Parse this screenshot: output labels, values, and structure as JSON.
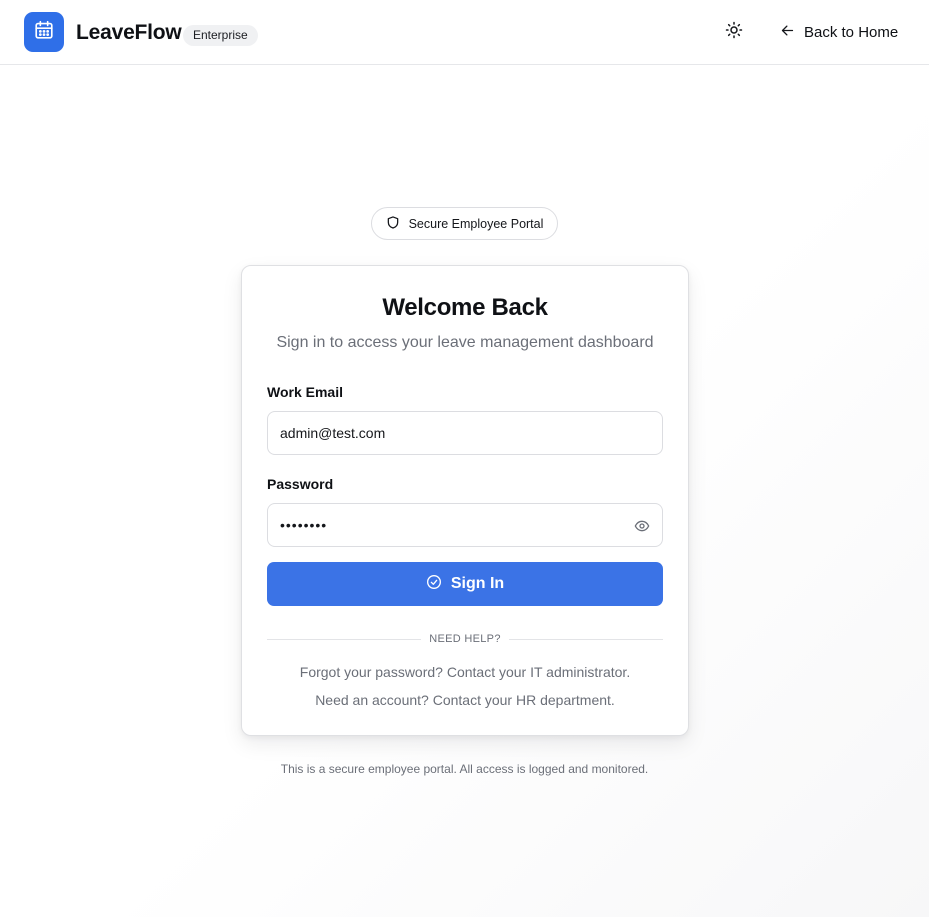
{
  "header": {
    "brand": "LeaveFlow",
    "badge": "Enterprise",
    "logo_icon": "calendar-icon",
    "theme_icon": "sun-icon",
    "back_icon": "arrow-left-icon",
    "back_label": "Back to Home"
  },
  "portal_pill": {
    "icon": "shield-icon",
    "label": "Secure Employee Portal"
  },
  "login_card": {
    "title": "Welcome Back",
    "subtitle": "Sign in to access your leave management dashboard",
    "email": {
      "label": "Work Email",
      "value": "admin@test.com"
    },
    "password": {
      "label": "Password",
      "value": "••••••••",
      "toggle_icon": "eye-icon"
    },
    "submit": {
      "icon": "check-circle-icon",
      "label": "Sign In"
    },
    "divider_text": "NEED HELP?",
    "help_lines": [
      "Forgot your password? Contact your IT administrator.",
      "Need an account? Contact your HR department."
    ]
  },
  "footer_note": "This is a secure employee portal. All access is logged and monitored.",
  "colors": {
    "primary": "#3b73e6",
    "logo_bg": "#2f6fe8",
    "muted_text": "#6b6f78",
    "border": "#dcdde1"
  }
}
